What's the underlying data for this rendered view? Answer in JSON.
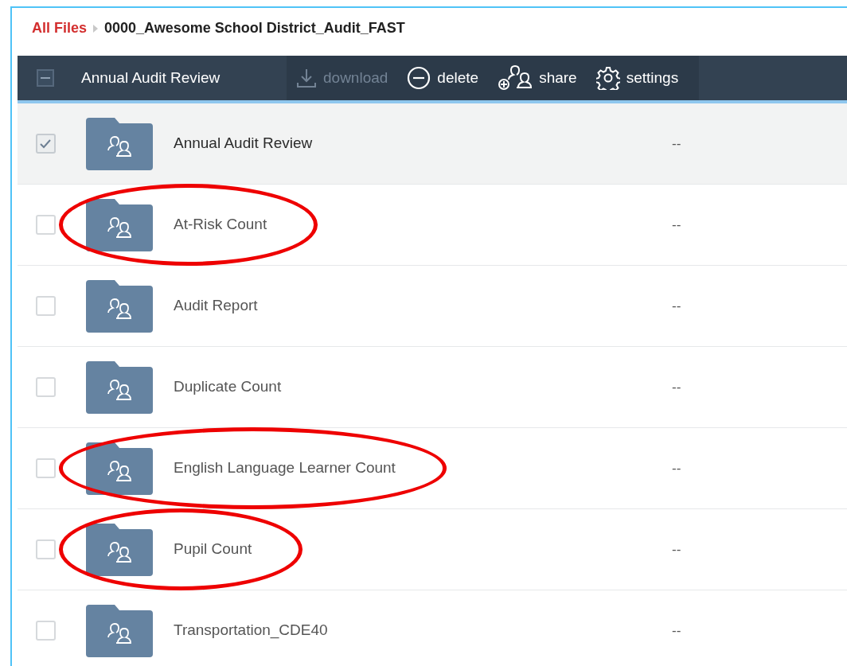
{
  "breadcrumb": [
    {
      "label": "All Files",
      "kind": "link"
    },
    {
      "label": "0000_Awesome School District_Audit_FAST",
      "kind": "current"
    }
  ],
  "toolbar": {
    "select_all": {
      "partial": true
    },
    "selection_label": "Annual Audit Review",
    "actions": [
      {
        "label": "download",
        "kind": "download",
        "disabled": true
      },
      {
        "label": "delete",
        "kind": "delete",
        "disabled": false
      },
      {
        "label": "share",
        "kind": "share",
        "disabled": false
      },
      {
        "label": "settings",
        "kind": "settings",
        "disabled": false
      }
    ]
  },
  "rows": [
    {
      "name": "Annual Audit Review",
      "column_2": "--",
      "checked": true,
      "circled": false
    },
    {
      "name": "At-Risk Count",
      "column_2": "--",
      "checked": false,
      "circled": true
    },
    {
      "name": "Audit Report",
      "column_2": "--",
      "checked": false,
      "circled": false
    },
    {
      "name": "Duplicate Count",
      "column_2": "--",
      "checked": false,
      "circled": false
    },
    {
      "name": "English Language Learner Count",
      "column_2": "--",
      "checked": false,
      "circled": true
    },
    {
      "name": "Pupil Count",
      "column_2": "--",
      "checked": false,
      "circled": true
    },
    {
      "name": "Transportation_CDE40",
      "column_2": "--",
      "checked": false,
      "circled": false
    }
  ]
}
